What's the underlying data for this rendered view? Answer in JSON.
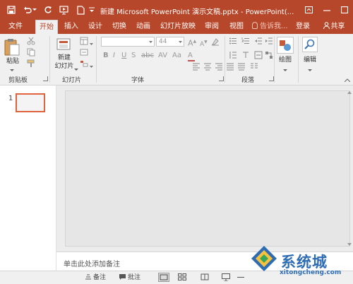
{
  "window": {
    "title": "新建 Microsoft PowerPoint 演示文稿.pptx - PowerPoint(...",
    "accent": "#b7472a"
  },
  "quick_access": {
    "icons": [
      "save-icon",
      "undo-icon",
      "redo-icon",
      "present-icon",
      "new-doc-icon",
      "customize-icon"
    ]
  },
  "tabs": [
    {
      "label": "文件",
      "active": false
    },
    {
      "label": "开始",
      "active": true
    },
    {
      "label": "插入",
      "active": false
    },
    {
      "label": "设计",
      "active": false
    },
    {
      "label": "切换",
      "active": false
    },
    {
      "label": "动画",
      "active": false
    },
    {
      "label": "幻灯片放映",
      "active": false
    },
    {
      "label": "审阅",
      "active": false
    },
    {
      "label": "视图",
      "active": false
    }
  ],
  "tell_me": "告诉我...",
  "login": "登录",
  "share": "共享",
  "ribbon": {
    "paste_label": "粘贴",
    "new_slide_label_1": "新建",
    "new_slide_label_2": "幻灯片",
    "font_size": "44",
    "drawing_label": "绘图",
    "editing_label": "编辑",
    "groups": {
      "clipboard": "剪贴板",
      "slides": "幻灯片",
      "font": "字体",
      "paragraph": "段落"
    }
  },
  "slides_pane": {
    "slide_number": "1"
  },
  "notes_placeholder": "单击此处添加备注",
  "status": {
    "notes_label": "备注",
    "comments_label": "批注"
  },
  "watermark": {
    "text": "系统城",
    "url": "xitongcheng.com"
  }
}
